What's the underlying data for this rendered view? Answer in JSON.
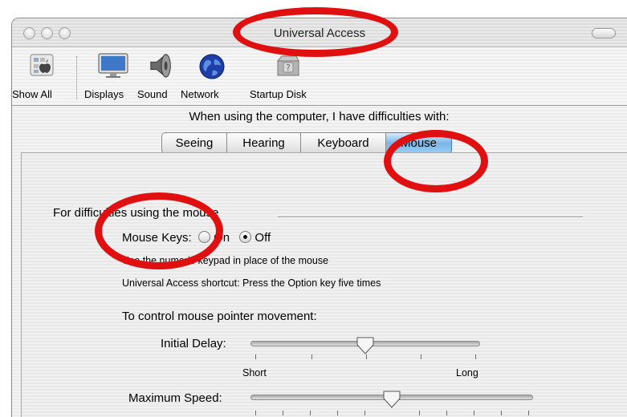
{
  "window": {
    "title": "Universal Access"
  },
  "toolbar": {
    "items": [
      {
        "label": "Show All",
        "icon": "apple-grid-icon"
      },
      {
        "label": "Displays",
        "icon": "display-monitor-icon"
      },
      {
        "label": "Sound",
        "icon": "speaker-icon"
      },
      {
        "label": "Network",
        "icon": "globe-icon"
      },
      {
        "label": "Startup Disk",
        "icon": "hard-disk-icon"
      }
    ]
  },
  "prompt": "When using the computer, I have difficulties with:",
  "tabs": [
    {
      "label": "Seeing",
      "active": false
    },
    {
      "label": "Hearing",
      "active": false
    },
    {
      "label": "Keyboard",
      "active": false
    },
    {
      "label": "Mouse",
      "active": true
    }
  ],
  "mouse_panel": {
    "section_title": "For difficulties using the mouse",
    "mouse_keys_label": "Mouse Keys:",
    "on_label": "On",
    "off_label": "Off",
    "mouse_keys_value": "Off",
    "hint": "Use the numeric keypad in place of the mouse",
    "shortcut": "Universal Access shortcut: Press the Option key five times",
    "movement_title": "To control mouse pointer movement:",
    "initial_delay": {
      "label": "Initial Delay:",
      "min_label": "Short",
      "max_label": "Long",
      "value_fraction": 0.5
    },
    "maximum_speed": {
      "label": "Maximum Speed:",
      "value_fraction": 0.5
    }
  },
  "annotation_color": "#e01010"
}
